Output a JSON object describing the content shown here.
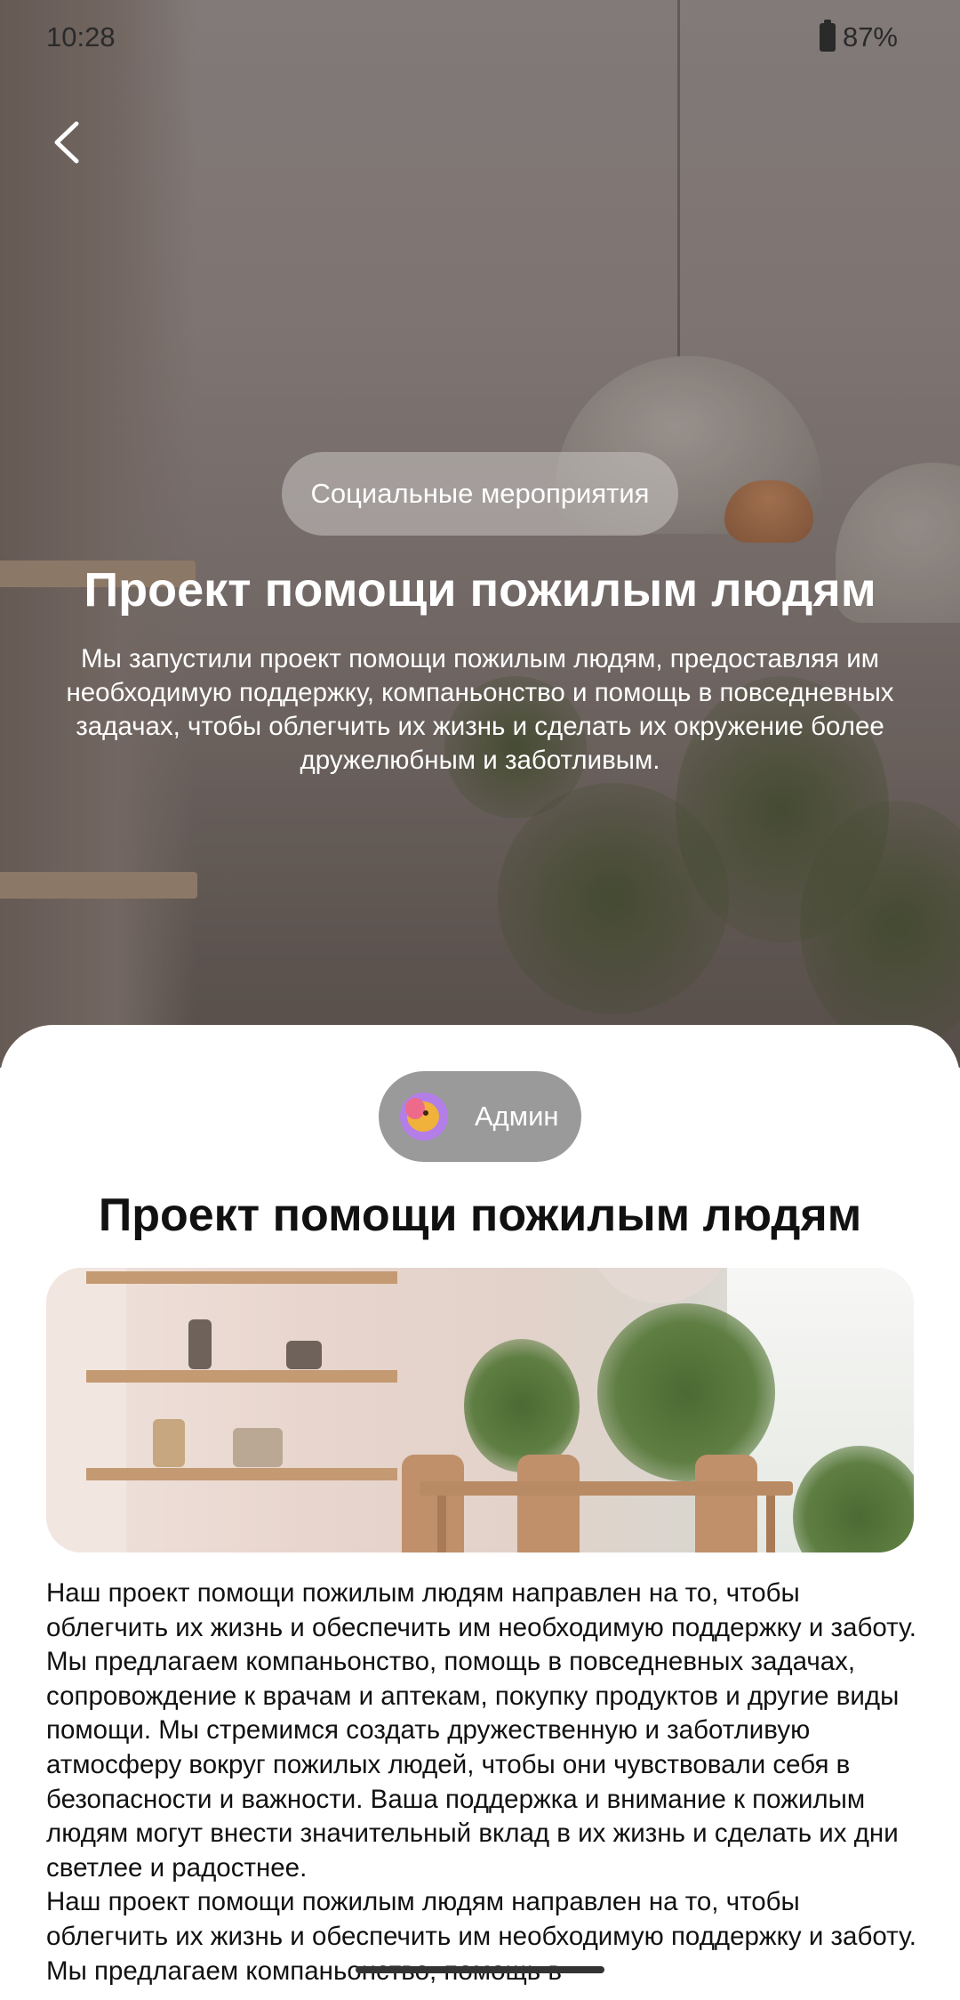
{
  "status_bar": {
    "time": "10:28",
    "battery": "87%",
    "battery_icon": "battery-icon"
  },
  "hero": {
    "back_icon": "chevron-left-icon",
    "category": "Социальные мероприятия",
    "title": "Проект помощи пожилым людям",
    "description": "Мы запустили проект помощи пожилым людям, предоставляя им необходимую поддержку, компаньонство и помощь в повседневных задачах, чтобы облегчить их жизнь и сделать их окружение более дружелюбным и заботливым."
  },
  "article": {
    "author_name": "Админ",
    "title": "Проект помощи пожилым людям",
    "paragraphs": [
      "Наш проект помощи пожилым людям направлен на то, чтобы облегчить их жизнь и обеспечить им необходимую поддержку и заботу. Мы предлагаем компаньонство, помощь в повседневных задачах, сопровождение к врачам и аптекам, покупку продуктов и другие виды помощи. Мы стремимся создать дружественную и заботливую атмосферу вокруг пожилых людей, чтобы они чувствовали себя в безопасности и важности. Ваша поддержка и внимание к пожилым людям могут внести значительный вклад в их жизнь и сделать их дни светлее и радостнее.",
      "Наш проект помощи пожилым людям направлен на то, чтобы облегчить их жизнь и обеспечить им необходимую поддержку и заботу. Мы предлагаем компаньонство, помощь в"
    ]
  },
  "colors": {
    "sheet_background": "#ffffff",
    "chip_background": "#9a9a9a",
    "text": "#111111"
  }
}
